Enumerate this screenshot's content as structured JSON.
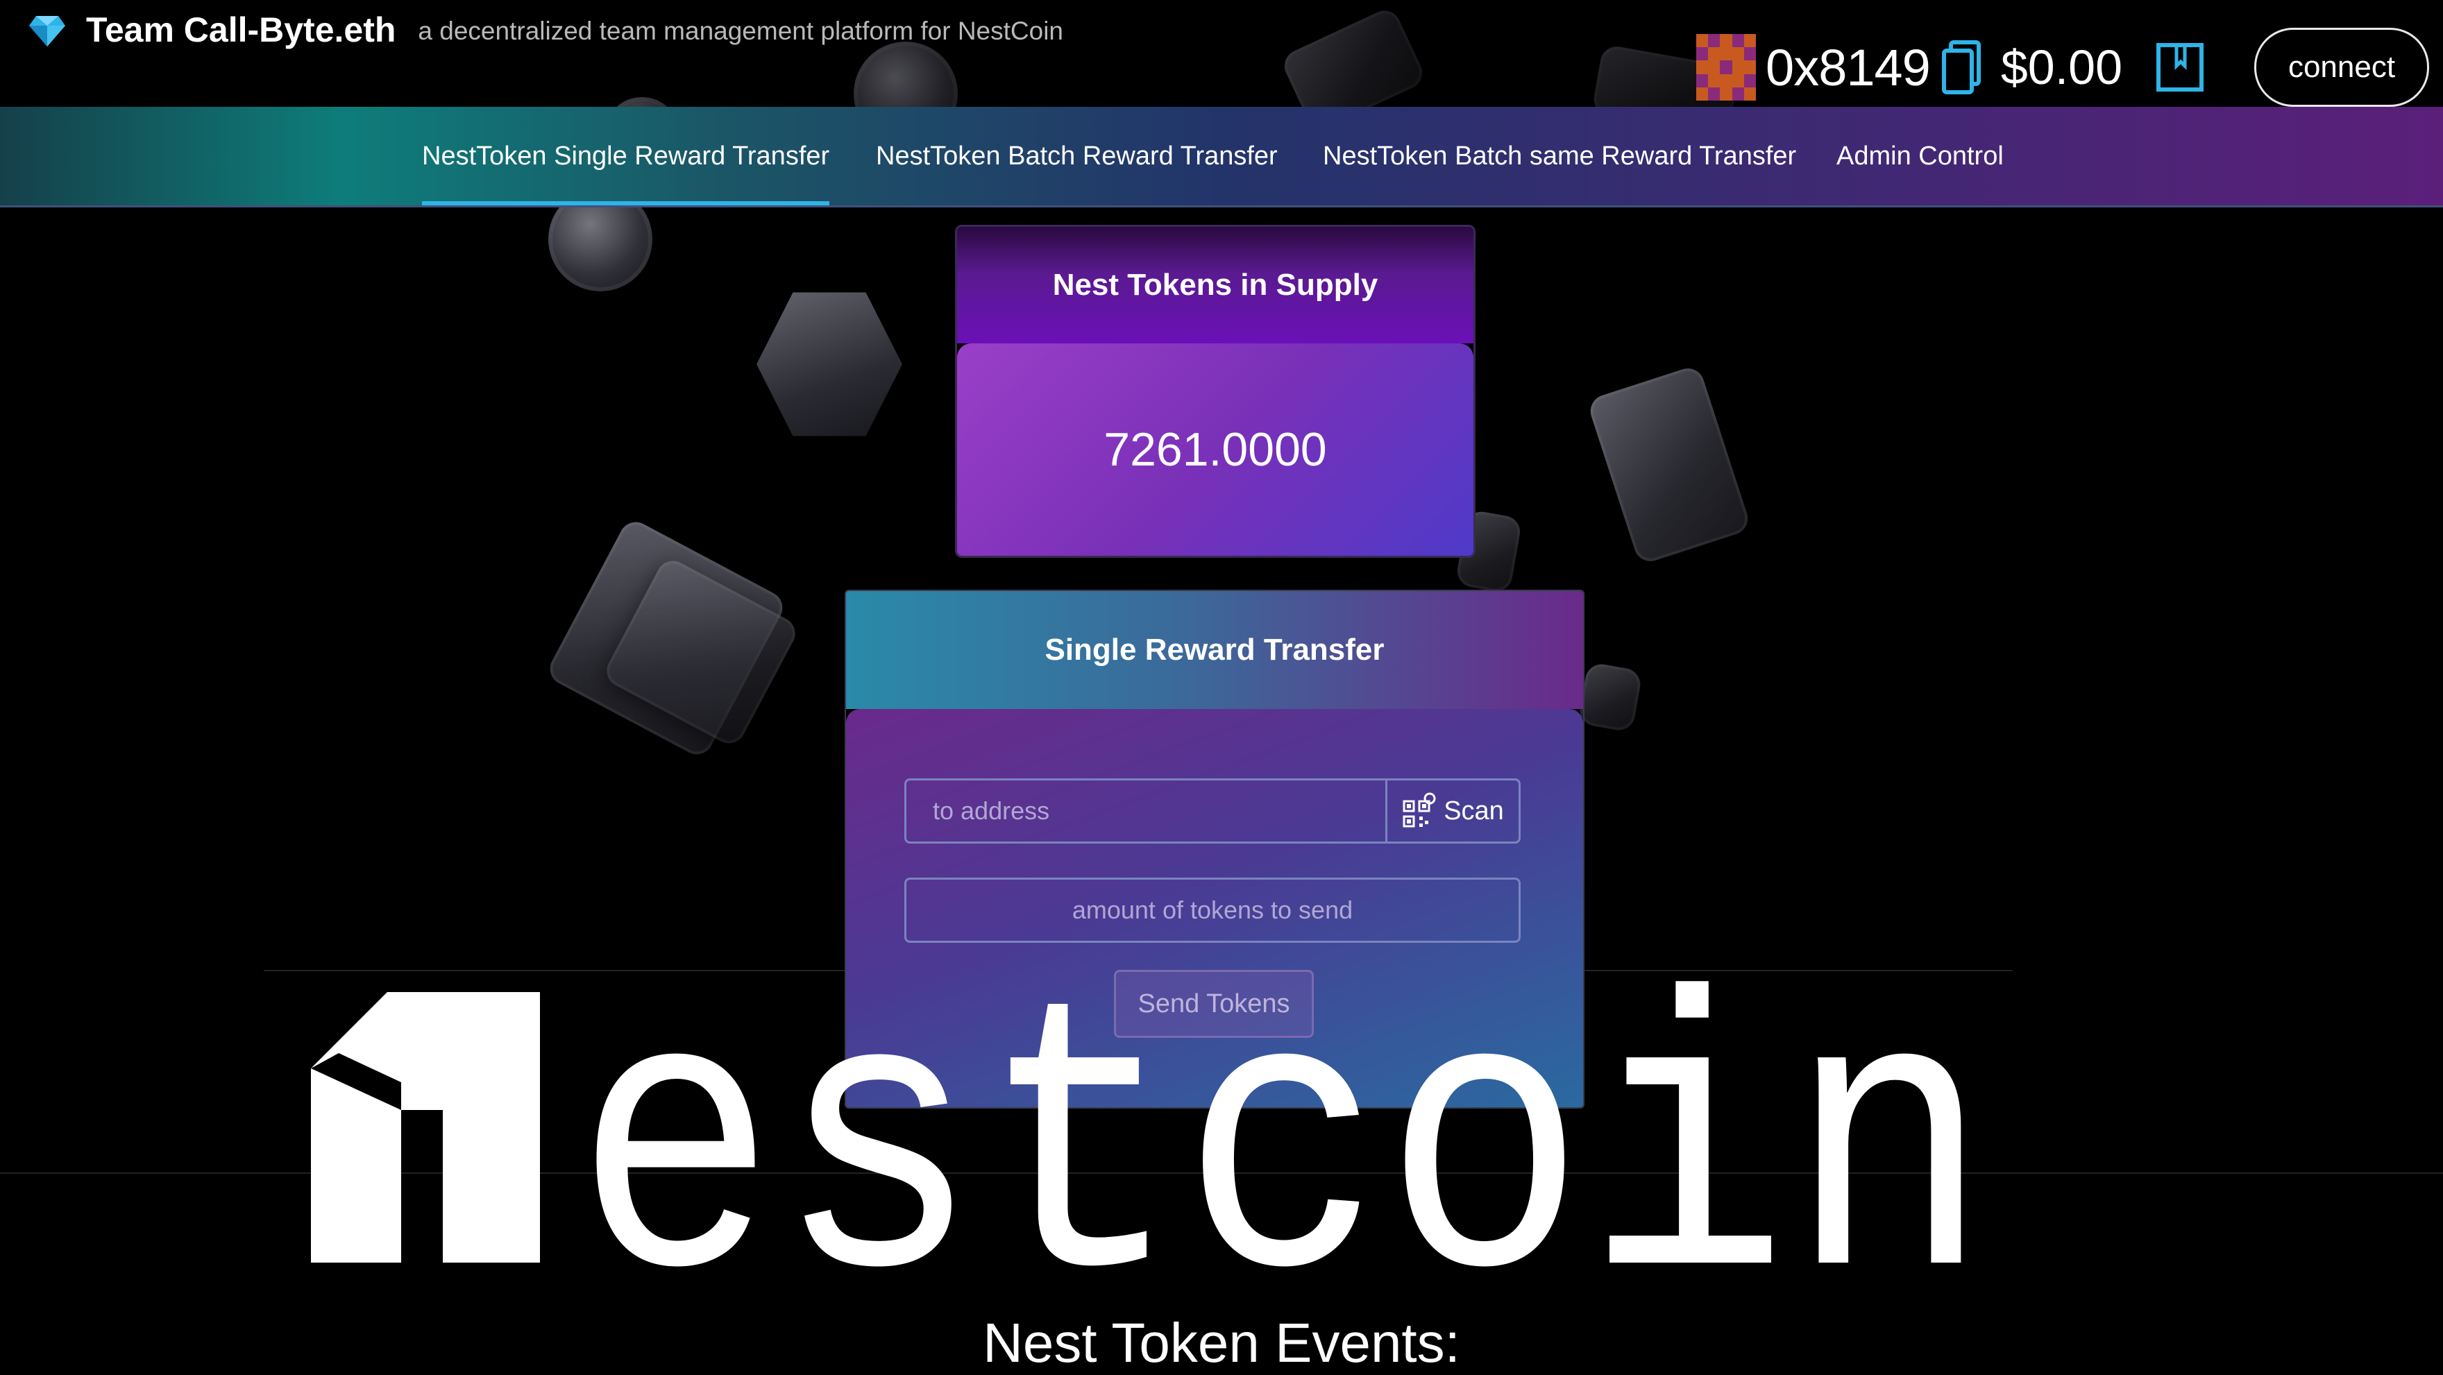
{
  "brand": {
    "title": "Team Call-Byte.eth",
    "subtitle": "a decentralized team management platform for NestCoin",
    "icon": "diamond-icon"
  },
  "account": {
    "address": "0x8149",
    "balance": "$0.00",
    "connect_label": "connect"
  },
  "nav": {
    "tabs": [
      {
        "label": "NestToken Single Reward Transfer",
        "active": true
      },
      {
        "label": "NestToken Batch Reward Transfer",
        "active": false
      },
      {
        "label": "NestToken Batch same Reward Transfer",
        "active": false
      },
      {
        "label": "Admin Control",
        "active": false
      }
    ]
  },
  "supply": {
    "title": "Nest Tokens in Supply",
    "value": "7261.0000"
  },
  "transfer": {
    "title": "Single Reward Transfer",
    "address_placeholder": "to address",
    "scan_label": "Scan",
    "amount_placeholder": "amount of tokens to send",
    "send_label": "Send Tokens"
  },
  "logo": {
    "text": "nestcoin"
  },
  "events": {
    "title": "Nest Token Events:"
  },
  "colors": {
    "accent": "#2fb4e8",
    "background": "#000000",
    "supply_card": "#7a30b8",
    "transfer_card": "#4a3a94"
  }
}
